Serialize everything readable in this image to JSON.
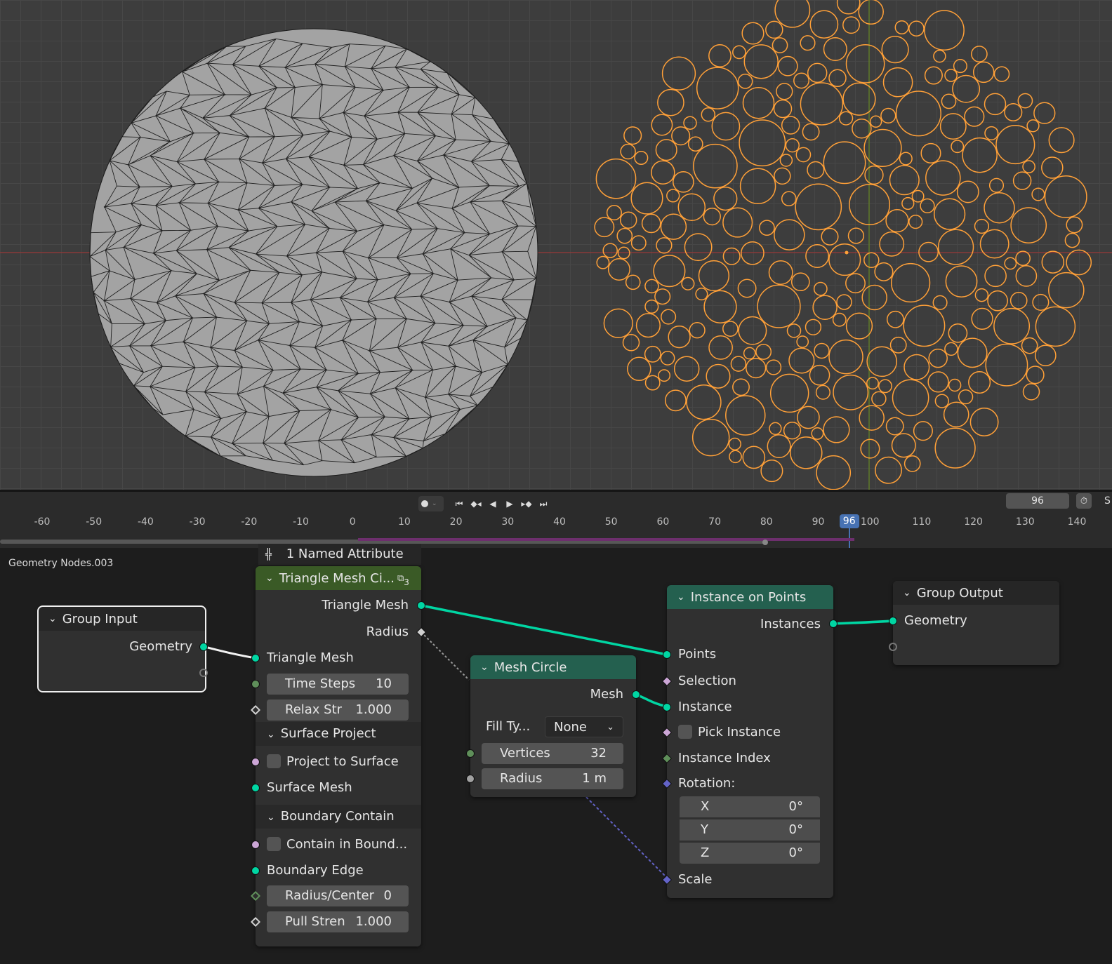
{
  "timeline": {
    "current_frame": "96",
    "frame_field": "96",
    "s_label": "S",
    "ruler_ticks": [
      "-60",
      "-50",
      "-40",
      "-30",
      "-20",
      "-10",
      "0",
      "10",
      "20",
      "30",
      "40",
      "50",
      "60",
      "70",
      "80",
      "90",
      "100",
      "110",
      "120",
      "130",
      "140"
    ]
  },
  "node_editor": {
    "tree_name": "Geometry Nodes.003",
    "named_attribute": "1 Named Attribute",
    "group_input": {
      "title": "Group Input",
      "geometry": "Geometry"
    },
    "triangle_node": {
      "title": "Triangle Mesh Ci...",
      "badge": "3",
      "out_triangle_mesh": "Triangle Mesh",
      "out_radius": "Radius",
      "in_triangle_mesh": "Triangle Mesh",
      "time_steps_label": "Time Steps",
      "time_steps_value": "10",
      "relax_label": "Relax Str",
      "relax_value": "1.000",
      "surface_panel": "Surface Project",
      "project_to_surface": "Project to Surface",
      "surface_mesh": "Surface Mesh",
      "boundary_panel": "Boundary Contain",
      "contain_in_bound": "Contain in Bound...",
      "boundary_edge": "Boundary Edge",
      "radius_center_label": "Radius/Center",
      "radius_center_value": "0",
      "pull_label": "Pull Stren",
      "pull_value": "1.000"
    },
    "mesh_circle": {
      "title": "Mesh Circle",
      "mesh": "Mesh",
      "fill_label": "Fill Ty...",
      "fill_value": "None",
      "vertices_label": "Vertices",
      "vertices_value": "32",
      "radius_label": "Radius",
      "radius_value": "1 m"
    },
    "instance_on_points": {
      "title": "Instance on Points",
      "instances": "Instances",
      "points": "Points",
      "selection": "Selection",
      "instance": "Instance",
      "pick_instance": "Pick Instance",
      "instance_index": "Instance Index",
      "rotation": "Rotation:",
      "x_label": "X",
      "x_value": "0°",
      "y_label": "Y",
      "y_value": "0°",
      "z_label": "Z",
      "z_value": "0°",
      "scale": "Scale"
    },
    "group_output": {
      "title": "Group Output",
      "geometry": "Geometry"
    }
  },
  "colors": {
    "geometry": "#00d6a3",
    "selection_outline": "#ffa038",
    "playhead": "#4772b3",
    "vector": "#6363c7",
    "boolean": "#cca6d6"
  }
}
